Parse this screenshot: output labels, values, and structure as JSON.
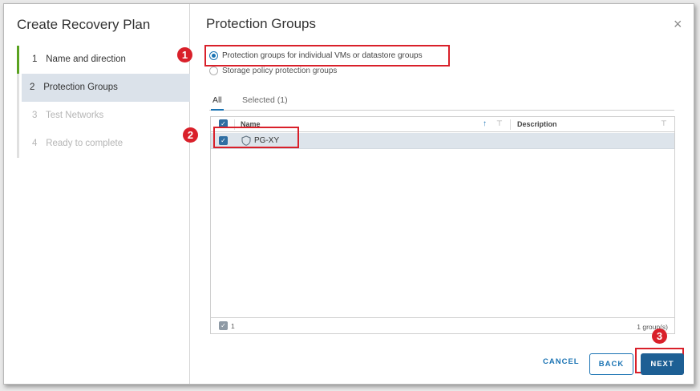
{
  "wizard": {
    "title": "Create Recovery Plan",
    "steps": [
      {
        "num": "1",
        "label": "Name and direction"
      },
      {
        "num": "2",
        "label": "Protection Groups"
      },
      {
        "num": "3",
        "label": "Test Networks"
      },
      {
        "num": "4",
        "label": "Ready to complete"
      }
    ]
  },
  "page": {
    "title": "Protection Groups",
    "close_glyph": "×"
  },
  "options": {
    "individual": "Protection groups for individual VMs or datastore groups",
    "storage_policy": "Storage policy protection groups"
  },
  "tabs": {
    "all": "All",
    "selected": "Selected (1)"
  },
  "grid": {
    "col_name": "Name",
    "col_description": "Description",
    "sort_glyph": "↑",
    "filter_glyph": "⊤",
    "rows": [
      {
        "name": "PG-XY",
        "description": ""
      }
    ],
    "footer_selected": "1",
    "footer_count": "1 group(s)"
  },
  "annotations": {
    "one": "1",
    "two": "2",
    "three": "3"
  },
  "buttons": {
    "cancel": "CANCEL",
    "back": "BACK",
    "next": "NEXT"
  },
  "colors": {
    "accent": "#1a73b3",
    "primary_button": "#1d5f94",
    "annotation_red": "#d9202a",
    "completed_step": "#5aa220",
    "selected_row": "#dde4eb"
  },
  "icons": {
    "protection_group": "shield-icon",
    "checkbox": "checkmark-icon",
    "close": "close-icon"
  }
}
